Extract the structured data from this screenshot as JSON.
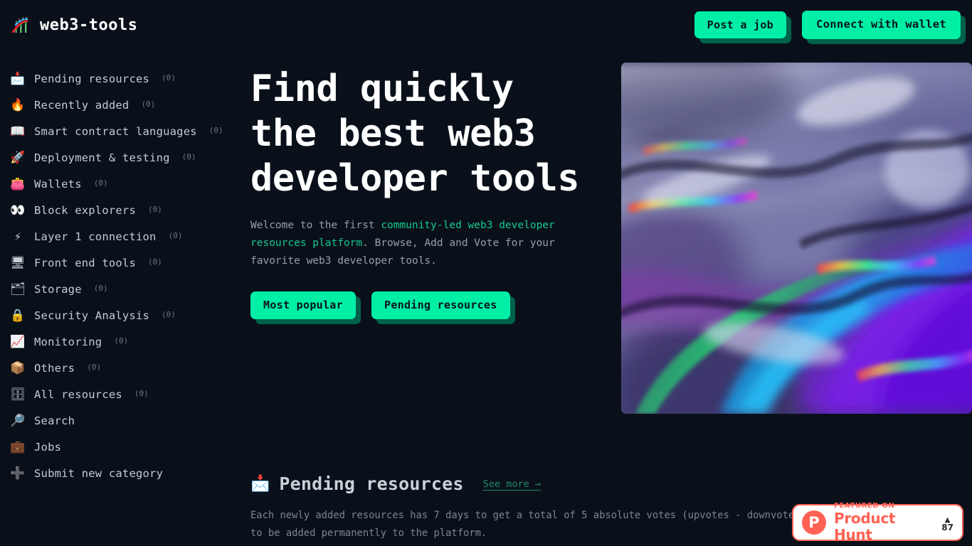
{
  "header": {
    "logo_icon": "roller-coaster-emoji",
    "logo_glyph": "🎢",
    "title": "web3-tools",
    "post_job_label": "Post a job",
    "connect_wallet_label": "Connect with wallet"
  },
  "colors": {
    "background": "#0a101a",
    "accent_green": "#00efa5",
    "accent_green_shadow": "#00624a",
    "link_green": "#17c98c",
    "text_primary": "#ffffff",
    "text_secondary": "#94a0ab",
    "text_muted": "#6d7782",
    "product_hunt_orange": "#ff6154"
  },
  "sidebar": {
    "items": [
      {
        "icon_name": "inbox-tray-icon",
        "glyph": "📩",
        "label": "Pending resources",
        "count": "(0)"
      },
      {
        "icon_name": "fire-icon",
        "glyph": "🔥",
        "label": "Recently added",
        "count": "(0)"
      },
      {
        "icon_name": "open-book-icon",
        "glyph": "📖",
        "label": "Smart contract languages",
        "count": "(0)"
      },
      {
        "icon_name": "rocket-icon",
        "glyph": "🚀",
        "label": "Deployment & testing",
        "count": "(0)"
      },
      {
        "icon_name": "purse-icon",
        "glyph": "👛",
        "label": "Wallets",
        "count": "(0)"
      },
      {
        "icon_name": "eyes-icon",
        "glyph": "👀",
        "label": "Block explorers",
        "count": "(0)"
      },
      {
        "icon_name": "high-voltage-icon",
        "glyph": "⚡",
        "label": "Layer 1 connection",
        "count": "(0)"
      },
      {
        "icon_name": "desktop-computer-icon",
        "glyph": "🖥",
        "label": "Front end tools",
        "count": "(0)"
      },
      {
        "icon_name": "card-file-box-icon",
        "glyph": "🗂",
        "label": "Storage",
        "count": "(0)"
      },
      {
        "icon_name": "lock-icon",
        "glyph": "🔒",
        "label": "Security Analysis",
        "count": "(0)"
      },
      {
        "icon_name": "chart-increasing-icon",
        "glyph": "📈",
        "label": "Monitoring",
        "count": "(0)"
      },
      {
        "icon_name": "package-icon",
        "glyph": "📦",
        "label": "Others",
        "count": "(0)"
      },
      {
        "icon_name": "file-cabinet-icon",
        "glyph": "🗄",
        "label": "All resources",
        "count": "(0)"
      },
      {
        "icon_name": "magnifying-glass-icon",
        "glyph": "🔎",
        "label": "Search",
        "count": ""
      },
      {
        "icon_name": "briefcase-icon",
        "glyph": "💼",
        "label": "Jobs",
        "count": ""
      },
      {
        "icon_name": "plus-icon",
        "glyph": "➕",
        "label": "Submit new category",
        "count": ""
      }
    ]
  },
  "hero": {
    "title": "Find quickly the best web3 developer tools",
    "sub_before": "Welcome to the first ",
    "sub_accent": "community-led web3 developer resources platform",
    "sub_after": ". Browse, Add and Vote for your favorite web3 developer tools.",
    "cta_primary": "Most popular",
    "cta_secondary": "Pending resources",
    "image_alt": "iridescent-holographic-abstract"
  },
  "section": {
    "emoji_name": "inbox-tray-icon",
    "emoji": "📩",
    "title": "Pending resources",
    "see_more": "See more →",
    "description": "Each newly added resources has 7 days to get a total of 5 absolute votes (upvotes - downvotes) to be added permanently to the platform."
  },
  "product_hunt": {
    "mark": "P",
    "kicker": "FEATURED ON",
    "name": "Product Hunt",
    "caret": "▲",
    "count": "87"
  }
}
